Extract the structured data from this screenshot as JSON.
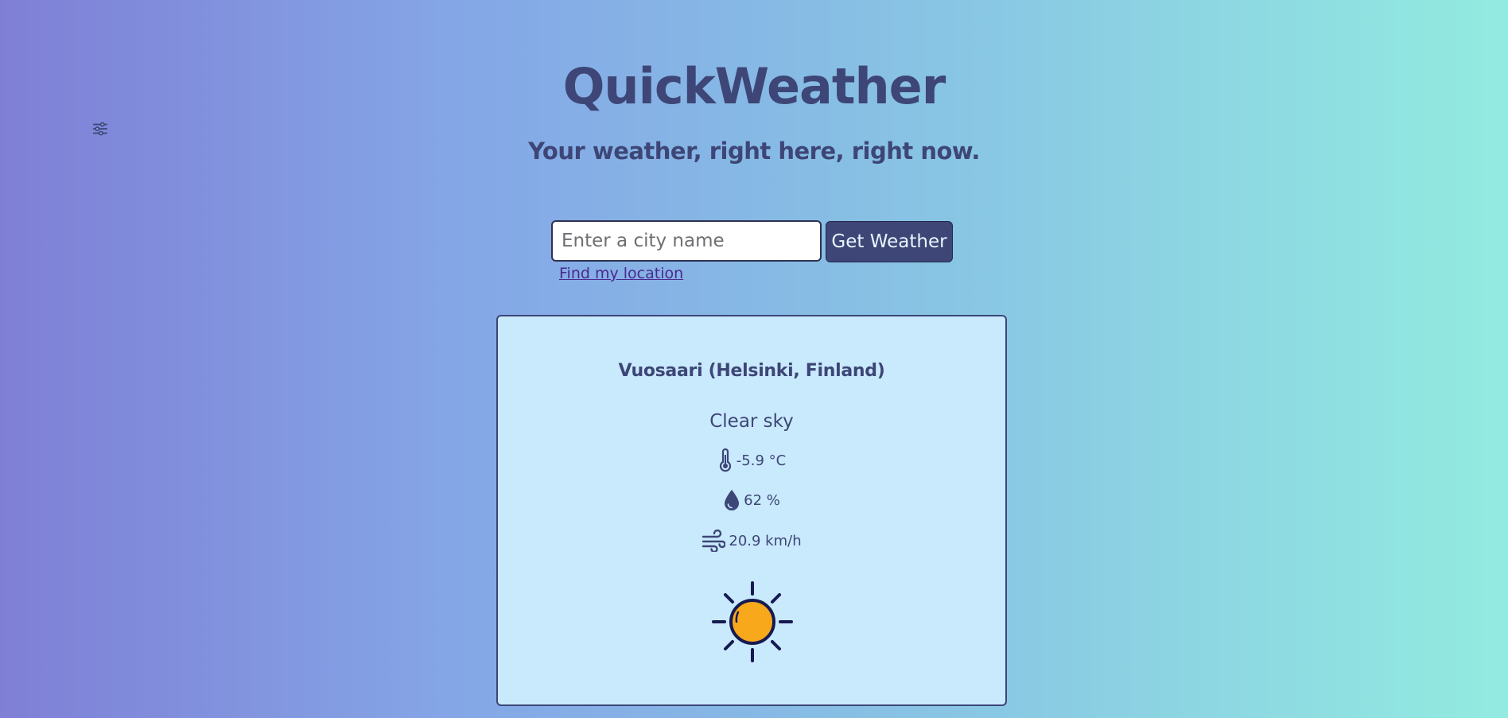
{
  "header": {
    "title": "QuickWeather",
    "subtitle": "Your weather, right here, right now."
  },
  "search": {
    "placeholder": "Enter a city name",
    "value": "",
    "button_label": "Get Weather",
    "find_location_label": "Find my location"
  },
  "weather": {
    "location": "Vuosaari (Helsinki, Finland)",
    "condition": "Clear sky",
    "temperature": "-5.9 °C",
    "humidity": "62 %",
    "wind": "20.9 km/h",
    "condition_icon": "sun-icon"
  },
  "icons": {
    "settings": "sliders-icon",
    "temperature": "thermometer-icon",
    "humidity": "droplet-icon",
    "wind": "wind-icon"
  },
  "colors": {
    "primary": "#3d4676",
    "card_background": "#c9e9fd",
    "sun": "#f7a81b",
    "link": "#4a2a8e"
  }
}
